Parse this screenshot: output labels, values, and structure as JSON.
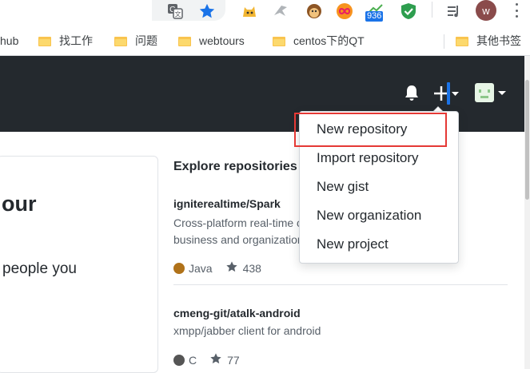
{
  "browser": {
    "extension_badge_count": "936",
    "profile_initial": "w"
  },
  "bookmarks": [
    {
      "label": "hub"
    },
    {
      "label": "找工作"
    },
    {
      "label": "问题"
    },
    {
      "label": "webtours"
    },
    {
      "label": "centos下的QT"
    },
    {
      "label": "其他书签"
    }
  ],
  "page": {
    "heading_fragment": "our",
    "text_fragment": "people you"
  },
  "explore": {
    "title": "Explore repositories",
    "repos": [
      {
        "name": "igniterealtime/Spark",
        "description_line1": "Cross-platform real-time collaboration client optimized for",
        "description_line2": "business and organizations.",
        "language": "Java",
        "language_color": "#b07219",
        "stars": "438"
      },
      {
        "name": "cmeng-git/atalk-android",
        "description_line1": "xmpp/jabber client for android",
        "language": "C",
        "language_color": "#555555",
        "stars": "77"
      }
    ]
  },
  "create_menu": {
    "items": [
      {
        "label": "New repository"
      },
      {
        "label": "Import repository"
      },
      {
        "label": "New gist"
      },
      {
        "label": "New organization"
      },
      {
        "label": "New project"
      }
    ]
  },
  "colors": {
    "header_bg": "#24292e",
    "highlight": "#e53935",
    "cursor": "#1a73e8"
  }
}
